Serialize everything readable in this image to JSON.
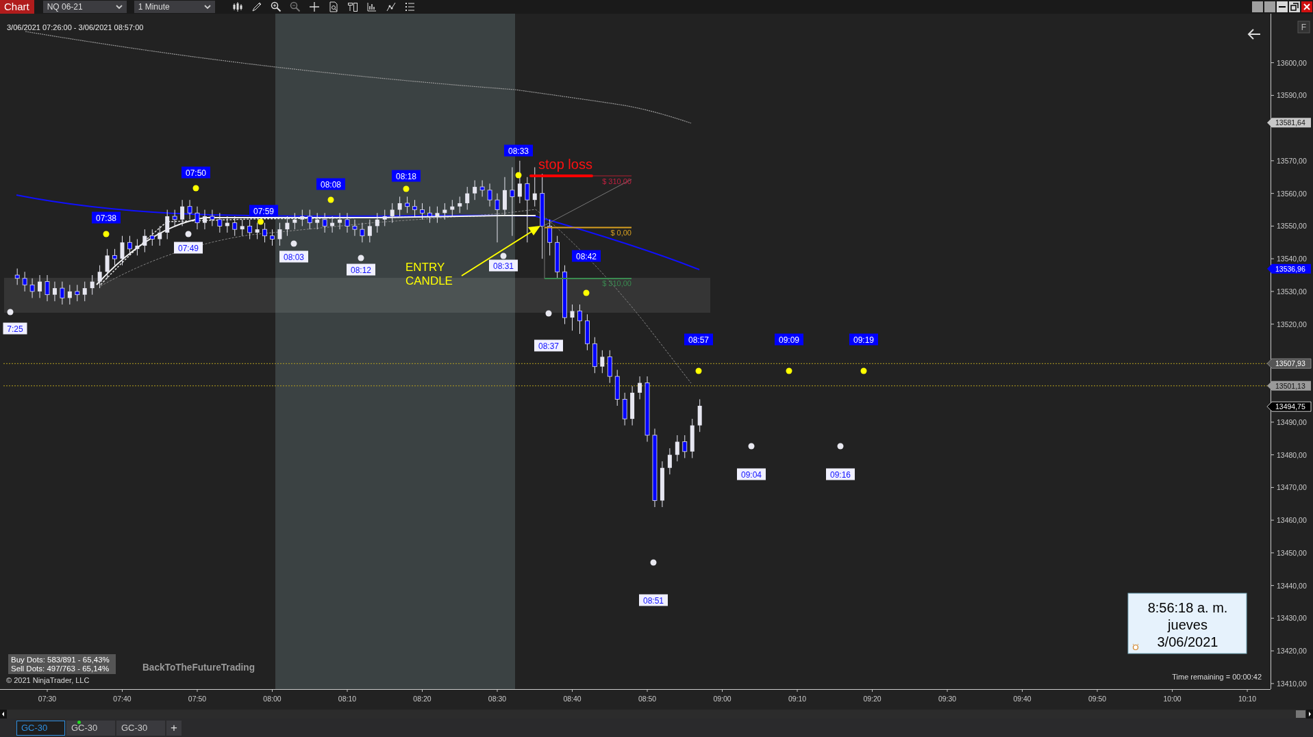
{
  "toolbar": {
    "title": "Chart",
    "instrument": "NQ 06-21",
    "interval": "1 Minute"
  },
  "range_text": "3/06/2021 07:26:00 - 3/06/2021 08:57:00",
  "chart_data": {
    "type": "candlestick",
    "xlim": [
      443.7,
      613.1
    ],
    "ylim": [
      13408.3,
      13615.0
    ],
    "x": [
      446,
      447,
      448,
      449,
      450,
      451,
      452,
      453,
      454,
      455,
      456,
      457,
      458,
      459,
      460,
      461,
      462,
      463,
      464,
      465,
      466,
      467,
      468,
      469,
      470,
      471,
      472,
      473,
      474,
      475,
      476,
      477,
      478,
      479,
      480,
      481,
      482,
      483,
      484,
      485,
      486,
      487,
      488,
      489,
      490,
      491,
      492,
      493,
      494,
      495,
      496,
      497,
      498,
      499,
      500,
      501,
      502,
      503,
      504,
      505,
      506,
      507,
      508,
      509,
      510,
      511,
      512,
      513,
      514,
      515,
      516,
      517,
      518,
      519,
      520,
      521,
      522,
      523,
      524,
      525,
      526,
      527,
      528,
      529,
      530,
      531,
      532,
      533,
      534,
      535,
      536,
      537
    ],
    "ohlc": [
      [
        13535,
        13537,
        13532,
        13534
      ],
      [
        13534,
        13536,
        13530,
        13532
      ],
      [
        13532,
        13534,
        13528,
        13530
      ],
      [
        13530,
        13535,
        13528,
        13533
      ],
      [
        13533,
        13535,
        13527,
        13529
      ],
      [
        13529,
        13533,
        13527,
        13531
      ],
      [
        13531,
        13533,
        13526,
        13528
      ],
      [
        13528,
        13532,
        13526,
        13530
      ],
      [
        13530,
        13532,
        13527,
        13529
      ],
      [
        13529,
        13533,
        13527,
        13531
      ],
      [
        13531,
        13535,
        13529,
        13533
      ],
      [
        13533,
        13538,
        13531,
        13536
      ],
      [
        13536,
        13543,
        13534,
        13541
      ],
      [
        13541,
        13543,
        13538,
        13540
      ],
      [
        13540,
        13547,
        13538,
        13545
      ],
      [
        13545,
        13547,
        13541,
        13543
      ],
      [
        13543,
        13546,
        13541,
        13544
      ],
      [
        13544,
        13549,
        13542,
        13547
      ],
      [
        13547,
        13549,
        13544,
        13546
      ],
      [
        13546,
        13550,
        13544,
        13548
      ],
      [
        13548,
        13555,
        13546,
        13553
      ],
      [
        13553,
        13555,
        13550,
        13552
      ],
      [
        13552,
        13558,
        13550,
        13556
      ],
      [
        13556,
        13558,
        13552,
        13554
      ],
      [
        13554,
        13556,
        13549,
        13551
      ],
      [
        13551,
        13555,
        13549,
        13553
      ],
      [
        13553,
        13555,
        13550,
        13552
      ],
      [
        13552,
        13554,
        13548,
        13550
      ],
      [
        13550,
        13553,
        13548,
        13551
      ],
      [
        13551,
        13553,
        13547,
        13549
      ],
      [
        13549,
        13552,
        13547,
        13550
      ],
      [
        13550,
        13552,
        13546,
        13548
      ],
      [
        13548,
        13551,
        13546,
        13549
      ],
      [
        13549,
        13551,
        13545,
        13547
      ],
      [
        13547,
        13549,
        13544,
        13546
      ],
      [
        13546,
        13551,
        13544,
        13549
      ],
      [
        13549,
        13553,
        13547,
        13551
      ],
      [
        13551,
        13554,
        13549,
        13552
      ],
      [
        13552,
        13555,
        13550,
        13553
      ],
      [
        13553,
        13555,
        13549,
        13551
      ],
      [
        13551,
        13554,
        13549,
        13552
      ],
      [
        13552,
        13554,
        13548,
        13550
      ],
      [
        13550,
        13553,
        13548,
        13551
      ],
      [
        13551,
        13554,
        13549,
        13552
      ],
      [
        13552,
        13554,
        13548,
        13550
      ],
      [
        13550,
        13552,
        13547,
        13549
      ],
      [
        13549,
        13551,
        13545,
        13547
      ],
      [
        13547,
        13552,
        13545,
        13550
      ],
      [
        13550,
        13554,
        13548,
        13552
      ],
      [
        13552,
        13555,
        13550,
        13553
      ],
      [
        13553,
        13557,
        13551,
        13555
      ],
      [
        13555,
        13559,
        13553,
        13557
      ],
      [
        13557,
        13559,
        13554,
        13556
      ],
      [
        13556,
        13558,
        13553,
        13555
      ],
      [
        13555,
        13557,
        13552,
        13554
      ],
      [
        13554,
        13556,
        13551,
        13553
      ],
      [
        13553,
        13556,
        13551,
        13554
      ],
      [
        13554,
        13557,
        13552,
        13555
      ],
      [
        13555,
        13558,
        13553,
        13556
      ],
      [
        13556,
        13559,
        13554,
        13557
      ],
      [
        13557,
        13562,
        13555,
        13560
      ],
      [
        13560,
        13564,
        13558,
        13562
      ],
      [
        13562,
        13564,
        13559,
        13561
      ],
      [
        13561,
        13563,
        13556,
        13558
      ],
      [
        13558,
        13560,
        13545,
        13555
      ],
      [
        13555,
        13565,
        13553,
        13561
      ],
      [
        13561,
        13568,
        13547,
        13559
      ],
      [
        13559,
        13570,
        13557,
        13563
      ],
      [
        13563,
        13565,
        13545,
        13558
      ],
      [
        13558,
        13568,
        13556,
        13560
      ],
      [
        13560,
        13566,
        13540,
        13550
      ],
      [
        13550,
        13552,
        13541,
        13545
      ],
      [
        13545,
        13547,
        13534,
        13536
      ],
      [
        13536,
        13538,
        13520,
        13522
      ],
      [
        13522,
        13526,
        13518,
        13524
      ],
      [
        13524,
        13526,
        13517,
        13521
      ],
      [
        13521,
        13523,
        13512,
        13514
      ],
      [
        13514,
        13516,
        13505,
        13507
      ],
      [
        13507,
        13512,
        13505,
        13510
      ],
      [
        13510,
        13512,
        13502,
        13504
      ],
      [
        13504,
        13506,
        13495,
        13497
      ],
      [
        13497,
        13499,
        13489,
        13491
      ],
      [
        13491,
        13501,
        13489,
        13499
      ],
      [
        13499,
        13504,
        13497,
        13502
      ],
      [
        13502,
        13504,
        13484,
        13486
      ],
      [
        13486,
        13488,
        13464,
        13466
      ],
      [
        13466,
        13478,
        13464,
        13476
      ],
      [
        13476,
        13482,
        13474,
        13480
      ],
      [
        13480,
        13486,
        13478,
        13484
      ],
      [
        13484,
        13486,
        13479,
        13481
      ],
      [
        13481,
        13491,
        13479,
        13489
      ],
      [
        13489,
        13497,
        13487,
        13495
      ]
    ],
    "xticks": [
      {
        "value": 450,
        "label": "07:30"
      },
      {
        "value": 460,
        "label": "07:40"
      },
      {
        "value": 470,
        "label": "07:50"
      },
      {
        "value": 480,
        "label": "08:00"
      },
      {
        "value": 490,
        "label": "08:10"
      },
      {
        "value": 500,
        "label": "08:20"
      },
      {
        "value": 510,
        "label": "08:30"
      },
      {
        "value": 520,
        "label": "08:40"
      },
      {
        "value": 530,
        "label": "08:50"
      },
      {
        "value": 540,
        "label": "09:00"
      },
      {
        "value": 550,
        "label": "09:10"
      },
      {
        "value": 560,
        "label": "09:20"
      },
      {
        "value": 570,
        "label": "09:30"
      },
      {
        "value": 580,
        "label": "09:40"
      },
      {
        "value": 590,
        "label": "09:50"
      },
      {
        "value": 600,
        "label": "10:00"
      },
      {
        "value": 610,
        "label": "10:10"
      }
    ],
    "yticks": [
      {
        "value": 13600,
        "label": "13600,00"
      },
      {
        "value": 13590,
        "label": "13590,00"
      },
      {
        "value": 13570,
        "label": "13570,00"
      },
      {
        "value": 13560,
        "label": "13560,00"
      },
      {
        "value": 13550,
        "label": "13550,00"
      },
      {
        "value": 13540,
        "label": "13540,00"
      },
      {
        "value": 13530,
        "label": "13530,00"
      },
      {
        "value": 13520,
        "label": "13520,00"
      },
      {
        "value": 13490,
        "label": "13490,00"
      },
      {
        "value": 13480,
        "label": "13480,00"
      },
      {
        "value": 13470,
        "label": "13470,00"
      },
      {
        "value": 13460,
        "label": "13460,00"
      },
      {
        "value": 13450,
        "label": "13450,00"
      },
      {
        "value": 13440,
        "label": "13440,00"
      },
      {
        "value": 13430,
        "label": "13430,00"
      },
      {
        "value": 13420,
        "label": "13420,00"
      },
      {
        "value": 13410,
        "label": "13410,00"
      }
    ]
  },
  "price_flags": [
    {
      "label": "13581,64",
      "kind": "light"
    },
    {
      "label": "13536,96",
      "kind": "blue"
    },
    {
      "label": "13507,93",
      "kind": "dark"
    },
    {
      "label": "13501,13",
      "kind": "grey"
    },
    {
      "label": "13494,75",
      "kind": "current"
    }
  ],
  "signals": [
    {
      "label": "7:25",
      "kind": "buy"
    },
    {
      "label": "07:38",
      "kind": "sell"
    },
    {
      "label": "07:49",
      "kind": "buy"
    },
    {
      "label": "07:50",
      "kind": "sell"
    },
    {
      "label": "07:59",
      "kind": "sell"
    },
    {
      "label": "08:03",
      "kind": "buy"
    },
    {
      "label": "08:08",
      "kind": "sell"
    },
    {
      "label": "08:12",
      "kind": "buy"
    },
    {
      "label": "08:18",
      "kind": "sell"
    },
    {
      "label": "08:31",
      "kind": "buy"
    },
    {
      "label": "08:33",
      "kind": "sell"
    },
    {
      "label": "08:37",
      "kind": "buy"
    },
    {
      "label": "08:42",
      "kind": "sell"
    },
    {
      "label": "08:51",
      "kind": "buy"
    },
    {
      "label": "08:57",
      "kind": "sell"
    },
    {
      "label": "09:04",
      "kind": "buy"
    },
    {
      "label": "09:09",
      "kind": "sell"
    },
    {
      "label": "09:16",
      "kind": "buy"
    },
    {
      "label": "09:19",
      "kind": "sell"
    }
  ],
  "trade": {
    "stop_label": "stop loss",
    "stop_amount": "$ 310,00",
    "entry_amount": "$ 0,00",
    "target_amount": "$ 310,00"
  },
  "annotation": [
    "ENTRY",
    "CANDLE"
  ],
  "stats": [
    "Buy Dots: 583/891 - 65,43%",
    "Sell Dots: 497/763 - 65,14%"
  ],
  "overlay_text": "BackToTheFutureTrading",
  "copyright": "© 2021 NinjaTrader, LLC",
  "time_remaining": "Time remaining = 00:00:42",
  "clock": {
    "time": "8:56:18 a. m.",
    "day": "jueves",
    "date": "3/06/2021"
  },
  "corner_button": "F",
  "tabs": [
    {
      "label": "GC-30",
      "selected": true,
      "alert": false
    },
    {
      "label": "GC-30",
      "selected": false,
      "alert": true
    },
    {
      "label": "GC-30",
      "selected": false,
      "alert": false
    }
  ],
  "add_tab": "+"
}
